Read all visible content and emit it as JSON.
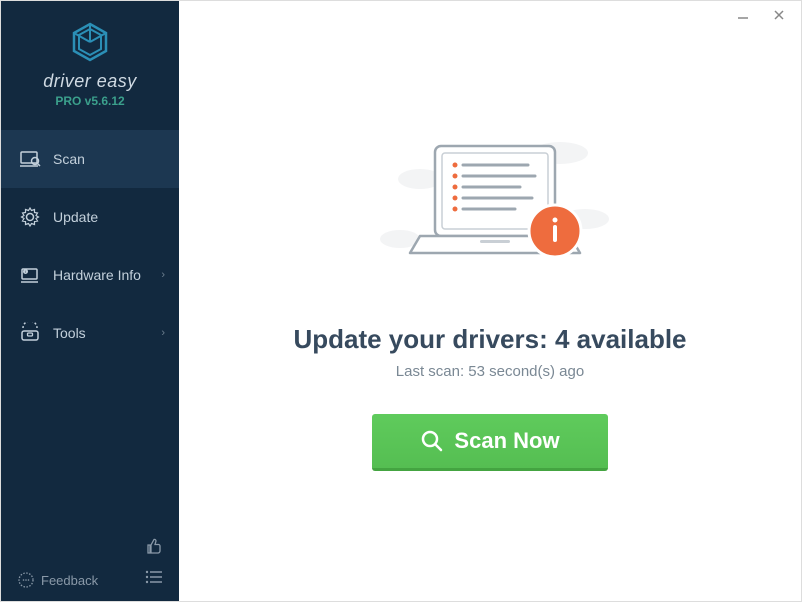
{
  "app": {
    "brand_first": "driver",
    "brand_second": "easy",
    "version": "PRO v5.6.12"
  },
  "sidebar": {
    "items": [
      {
        "label": "Scan",
        "has_chevron": false
      },
      {
        "label": "Update",
        "has_chevron": false
      },
      {
        "label": "Hardware Info",
        "has_chevron": true
      },
      {
        "label": "Tools",
        "has_chevron": true
      }
    ],
    "feedback_label": "Feedback"
  },
  "main": {
    "headline": "Update your drivers: 4 available",
    "subtext": "Last scan: 53 second(s) ago",
    "scan_button_label": "Scan Now"
  },
  "colors": {
    "accent_teal": "#2B8FB6",
    "sidebar_bg": "#12293F",
    "headline": "#374A5E",
    "button_green": "#5FCB5C",
    "info_orange": "#EE6C3E"
  }
}
